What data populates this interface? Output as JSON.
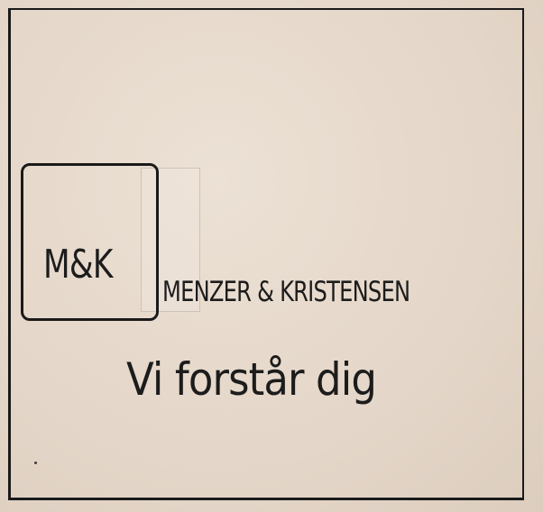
{
  "logo": {
    "text": "M&K"
  },
  "company": {
    "name": "MENZER & KRISTENSEN"
  },
  "tagline": {
    "text": "Vi forstår dig"
  },
  "colors": {
    "paper": "#e6d9cc",
    "ink": "#1a1a1a"
  }
}
